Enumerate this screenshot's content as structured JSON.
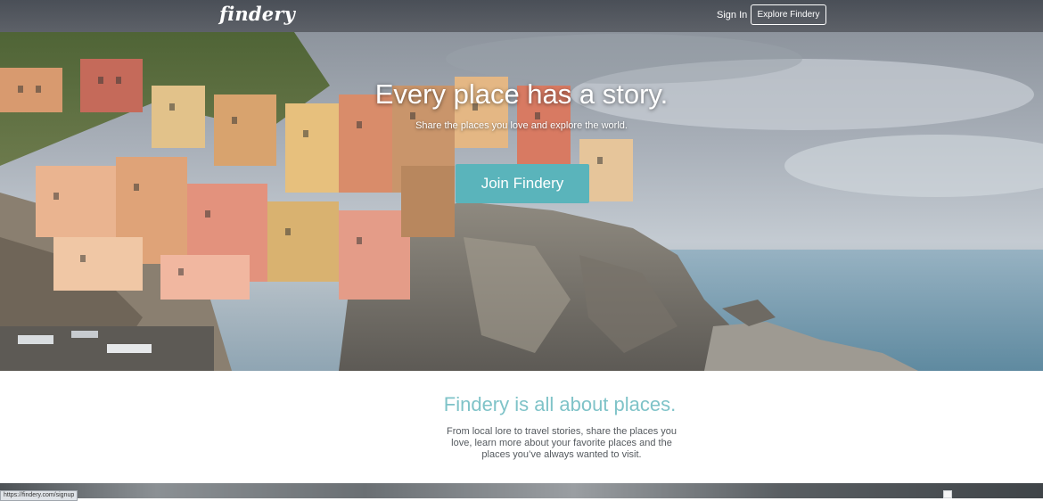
{
  "nav": {
    "logo": "findery",
    "sign_in": "Sign In",
    "explore": "Explore Findery"
  },
  "hero": {
    "title": "Every place has a story.",
    "subtitle": "Share the places you love and explore the world.",
    "cta": "Join Findery"
  },
  "about": {
    "title": "Findery is all about places.",
    "line1": "From local lore to travel stories, share the places you",
    "line2": "love, learn more about your favorite places and the",
    "line3": "places you’ve always wanted to visit."
  },
  "status_bar": {
    "url": "https://findery.com/signup"
  },
  "colors": {
    "accent": "#5ab4bb",
    "heading_teal": "#7fc3c8"
  }
}
